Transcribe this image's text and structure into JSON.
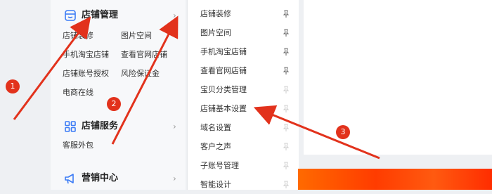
{
  "sidebar": {
    "sections": [
      {
        "title": "店铺管理",
        "icon": "store-icon",
        "links": [
          "店铺装修",
          "图片空间",
          "手机淘宝店铺",
          "查看官网店铺",
          "店铺账号授权",
          "风险保证金",
          "电商在线"
        ]
      },
      {
        "title": "店铺服务",
        "icon": "grid-apps-icon",
        "links": [
          "客服外包"
        ]
      },
      {
        "title": "营销中心",
        "icon": "megaphone-icon",
        "links": []
      }
    ]
  },
  "submenu": {
    "items": [
      "店铺装修",
      "图片空间",
      "手机淘宝店铺",
      "查看官网店铺",
      "宝贝分类管理",
      "店铺基本设置",
      "域名设置",
      "客户之声",
      "子账号管理",
      "智能设计"
    ],
    "pinned": [
      true,
      true,
      true,
      true,
      false,
      false,
      false,
      false,
      false,
      false
    ]
  },
  "annotations": {
    "badges": [
      "1",
      "2",
      "3"
    ],
    "color": "#e2321c"
  },
  "colors": {
    "accent": "#3c7cf6",
    "banner": "#ff5a10"
  }
}
